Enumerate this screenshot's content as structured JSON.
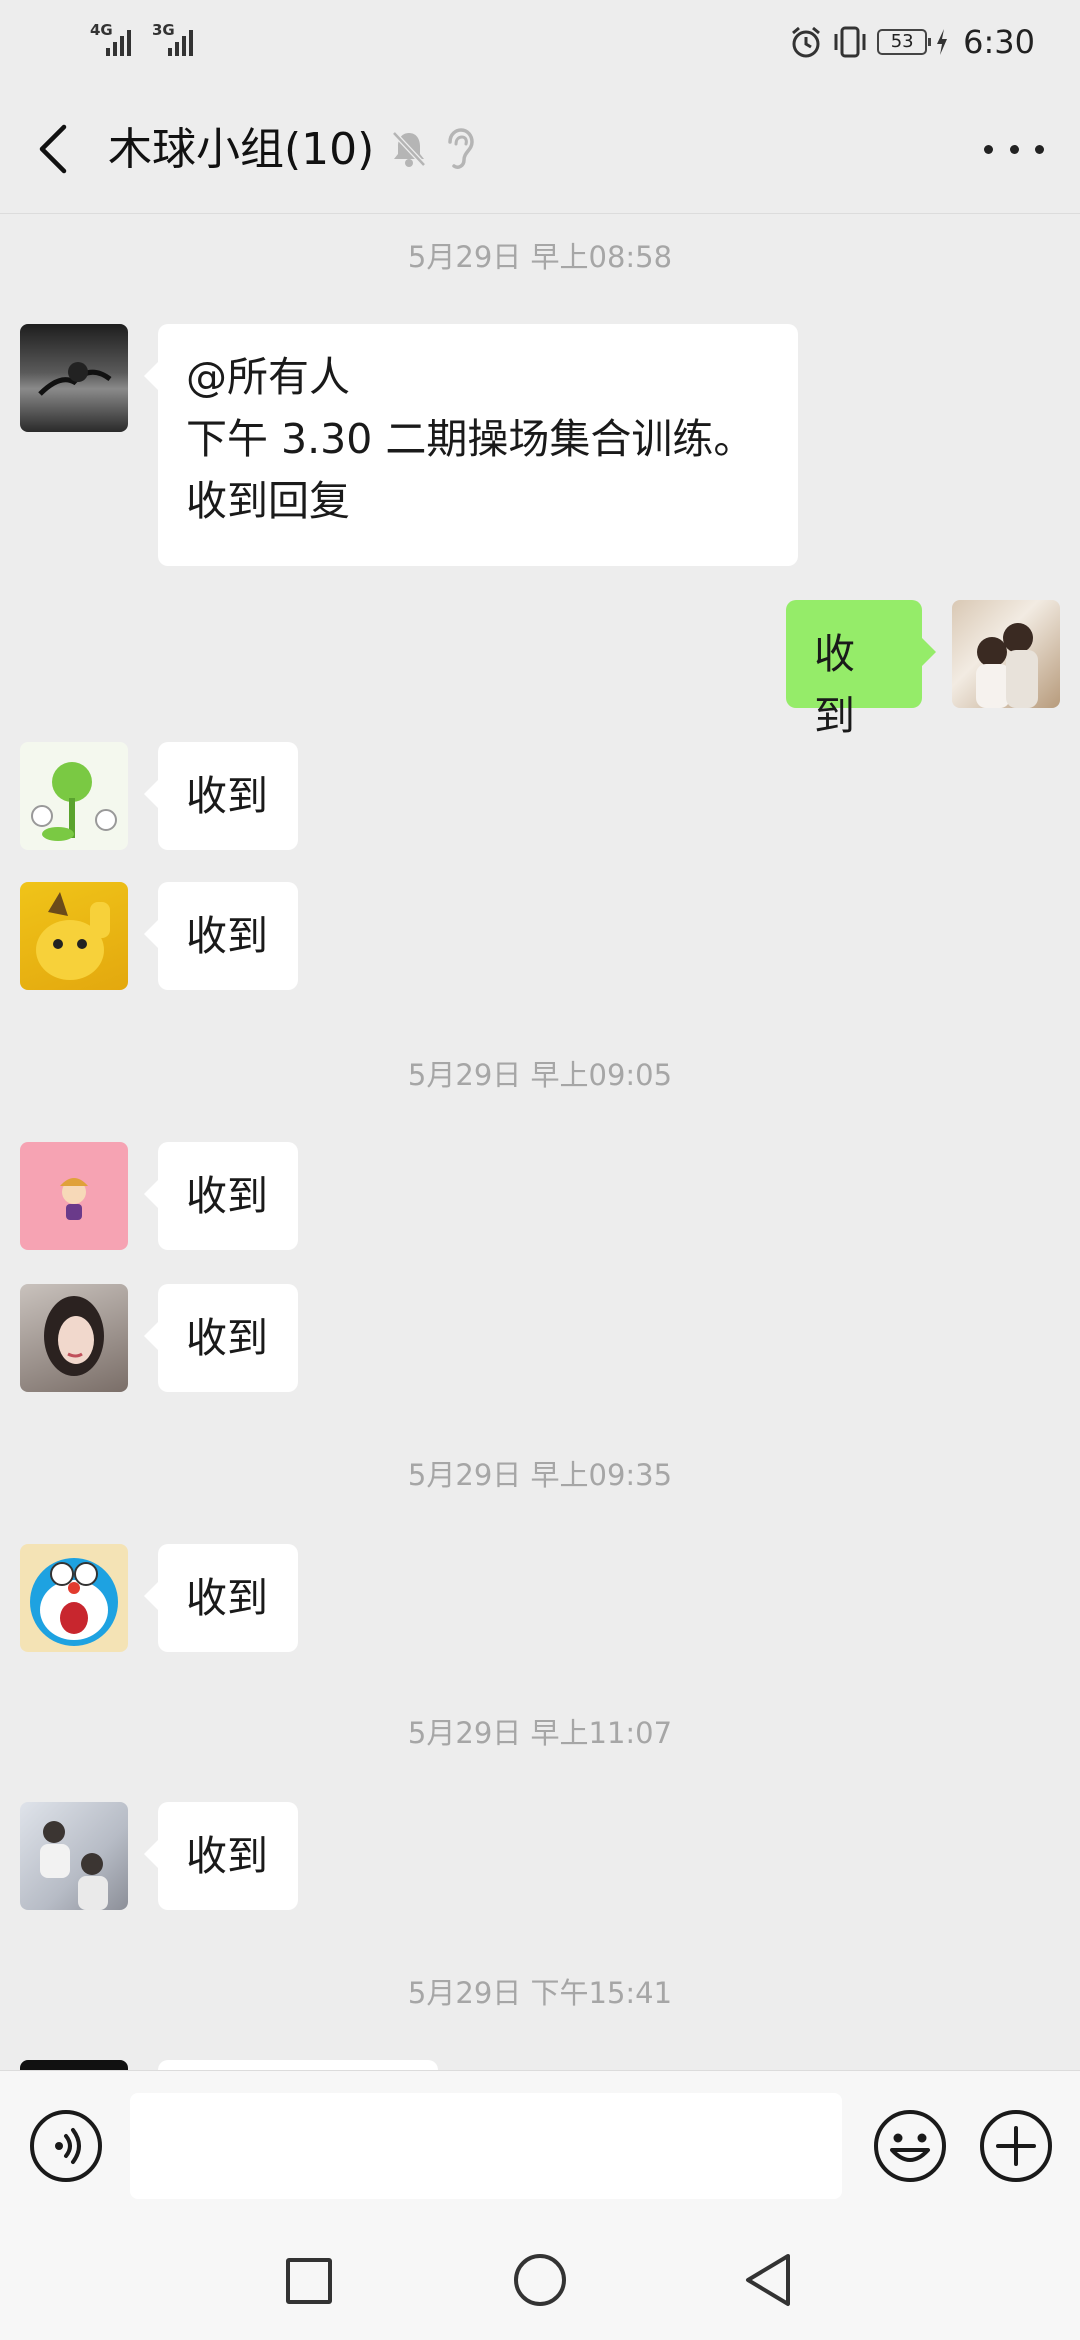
{
  "status_bar": {
    "network_1": "4G",
    "network_2": "3G",
    "battery": "53",
    "time": "6:30"
  },
  "header": {
    "title": "木球小组(10)",
    "back_icon": "chevron-left-icon",
    "mute_icon": "bell-off-icon",
    "ear_icon": "ear-icon",
    "more_icon": "more-dots-icon"
  },
  "messages": [
    {
      "type": "timestamp",
      "text": "5月29日 早上08:58"
    },
    {
      "type": "incoming",
      "lines": [
        "@所有人",
        "下午 3.30 二期操场集合训练。",
        "收到回复"
      ]
    },
    {
      "type": "outgoing",
      "text": "收到"
    },
    {
      "type": "incoming",
      "text": "收到"
    },
    {
      "type": "incoming",
      "text": "收到"
    },
    {
      "type": "timestamp",
      "text": "5月29日 早上09:05"
    },
    {
      "type": "incoming",
      "text": "收到"
    },
    {
      "type": "incoming",
      "text": "收到"
    },
    {
      "type": "timestamp",
      "text": "5月29日 早上09:35"
    },
    {
      "type": "incoming",
      "text": "收到"
    },
    {
      "type": "timestamp",
      "text": "5月29日 早上11:07"
    },
    {
      "type": "incoming",
      "text": "收到"
    },
    {
      "type": "timestamp",
      "text": "5月29日 下午15:41"
    }
  ],
  "input_bar": {
    "voice_icon": "voice-icon",
    "emoji_icon": "emoji-icon",
    "plus_icon": "plus-circle-icon",
    "input_value": ""
  },
  "nav_bar": {
    "recent_icon": "square-icon",
    "home_icon": "circle-icon",
    "back_icon": "triangle-back-icon"
  },
  "colors": {
    "background": "#ededed",
    "bubble_in": "#ffffff",
    "bubble_out": "#95ec69",
    "timestamp": "#a6a6a6"
  }
}
